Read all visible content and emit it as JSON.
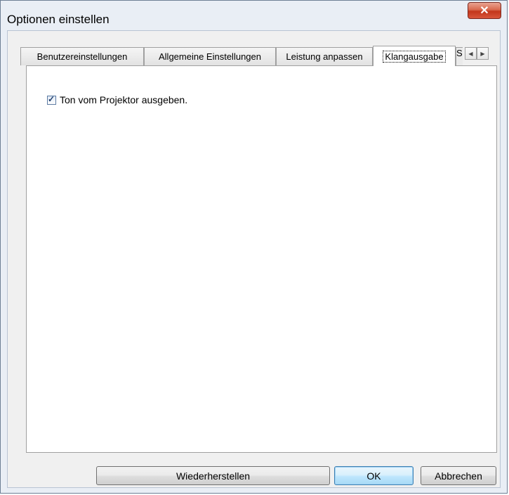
{
  "window": {
    "title": "Optionen einstellen"
  },
  "tabs": [
    {
      "label": "Benutzereinstellungen"
    },
    {
      "label": "Allgemeine Einstellungen"
    },
    {
      "label": "Leistung anpassen"
    },
    {
      "label": "Klangausgabe"
    }
  ],
  "tab_overflow_fragment": "S",
  "options": {
    "sound_checkbox": {
      "label": "Ton vom Projektor ausgeben.",
      "checked": true
    }
  },
  "buttons": {
    "restore": "Wiederherstellen",
    "ok": "OK",
    "cancel": "Abbrechen"
  },
  "icons": {
    "close": "close-x-icon",
    "scroll_left": "arrow-left-icon",
    "scroll_right": "arrow-right-icon",
    "check": "checkmark-icon"
  }
}
